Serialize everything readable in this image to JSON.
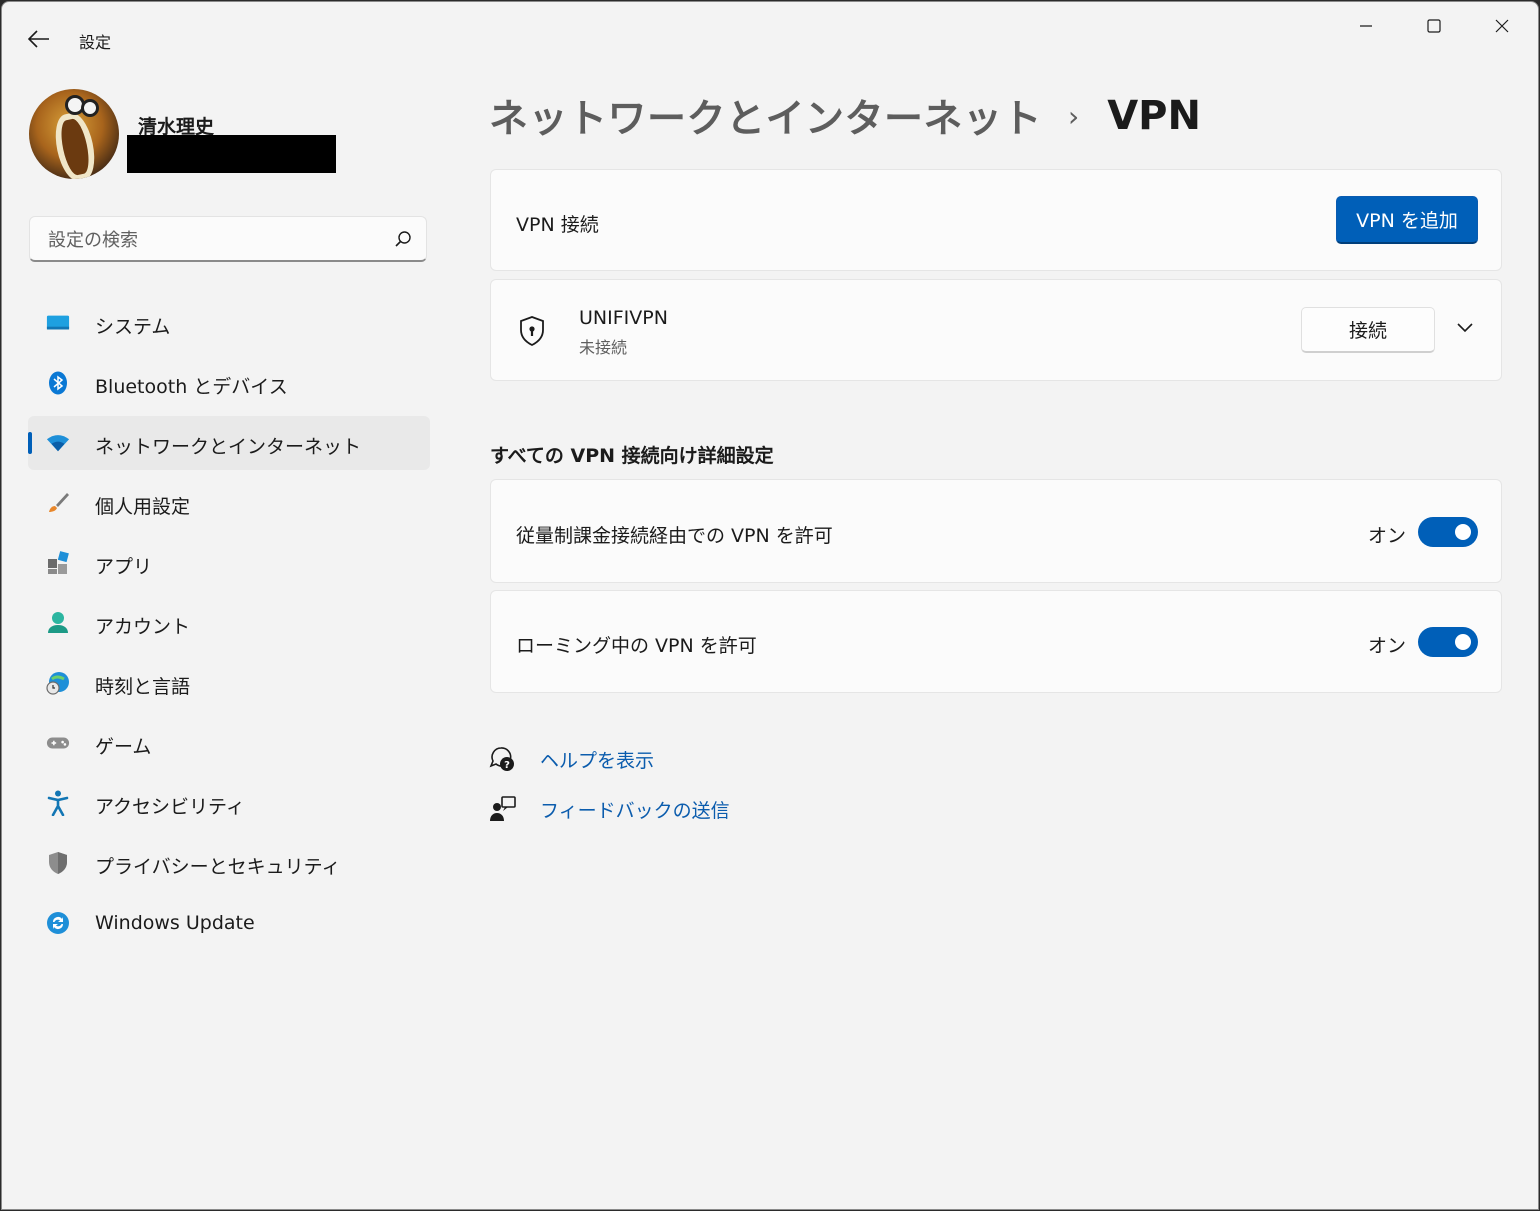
{
  "window": {
    "title": "設定"
  },
  "profile": {
    "name": "清水理史"
  },
  "search": {
    "placeholder": "設定の検索"
  },
  "sidebar": {
    "items": [
      {
        "label": "システム",
        "icon": "system-icon"
      },
      {
        "label": "Bluetooth とデバイス",
        "icon": "bluetooth-icon"
      },
      {
        "label": "ネットワークとインターネット",
        "icon": "wifi-icon",
        "active": true
      },
      {
        "label": "個人用設定",
        "icon": "paintbrush-icon"
      },
      {
        "label": "アプリ",
        "icon": "apps-icon"
      },
      {
        "label": "アカウント",
        "icon": "account-icon"
      },
      {
        "label": "時刻と言語",
        "icon": "globe-clock-icon"
      },
      {
        "label": "ゲーム",
        "icon": "gamepad-icon"
      },
      {
        "label": "アクセシビリティ",
        "icon": "accessibility-icon"
      },
      {
        "label": "プライバシーとセキュリティ",
        "icon": "shield-icon"
      },
      {
        "label": "Windows Update",
        "icon": "update-icon"
      }
    ]
  },
  "breadcrumb": {
    "parent": "ネットワークとインターネット",
    "separator": "›",
    "current": "VPN"
  },
  "vpn_connections": {
    "label": "VPN 接続",
    "add_button": "VPN を追加"
  },
  "vpn_entry": {
    "name": "UNIFIVPN",
    "status": "未接続",
    "connect_button": "接続"
  },
  "advanced": {
    "title": "すべての VPN 接続向け詳細設定",
    "settings": [
      {
        "label": "従量制課金接続経由での VPN を許可",
        "state": "オン",
        "on": true
      },
      {
        "label": "ローミング中の VPN を許可",
        "state": "オン",
        "on": true
      }
    ]
  },
  "links": {
    "help": "ヘルプを表示",
    "feedback": "フィードバックの送信"
  },
  "colors": {
    "accent": "#005fb8",
    "link": "#0b5cad",
    "background": "#f3f3f3",
    "card": "#fbfbfb"
  }
}
